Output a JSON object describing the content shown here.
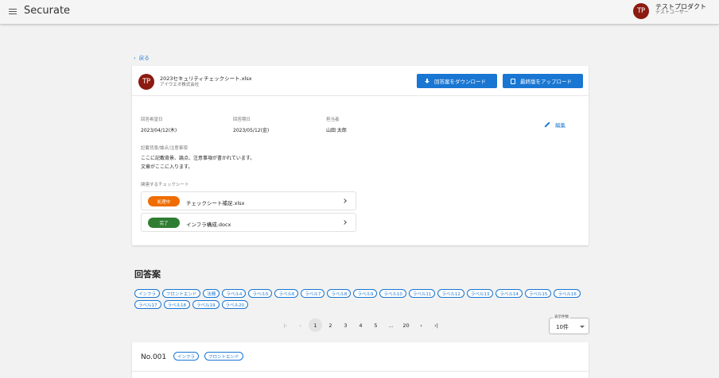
{
  "app": {
    "title": "Securate",
    "user_initials": "TP",
    "user_name": "テストプロダクト",
    "user_role": "テストユーザー"
  },
  "nav": {
    "back_label": "戻る"
  },
  "sheet": {
    "avatar_initials": "TP",
    "file_name": "2023セキュリティチェックシート.xlsx",
    "company": "アイウエオ株式会社",
    "download_button": "回答案をダウンロード",
    "upload_button": "最終版をアップロード",
    "desired_date_label": "回答希望日",
    "desired_date": "2023/04/12(木)",
    "due_date_label": "回答期日",
    "due_date": "2023/05/12(金)",
    "assignee_label": "担当者",
    "assignee": "山田 太郎",
    "edit_label": "編集",
    "notes_label": "記載背景/論点/注意事項",
    "notes_line1": "ここに記載背景、論点、注意事項が書かれています。",
    "notes_line2": "文章がここに入ります。",
    "related_label": "関連するチェックシート",
    "related": [
      {
        "status": "処理中",
        "status_color": "#ef6c00",
        "name": "チェックシート補足.xlsx"
      },
      {
        "status": "完了",
        "status_color": "#2e7d32",
        "name": "インフラ構成.docx"
      }
    ]
  },
  "answers": {
    "title": "回答案",
    "tags": [
      "インフラ",
      "フロントエンド",
      "法務",
      "ラベル4",
      "ラベル5",
      "ラベル6",
      "ラベル7",
      "ラベル8",
      "ラベル9",
      "ラベル10",
      "ラベル11",
      "ラベル12",
      "ラベル13",
      "ラベル14",
      "ラベル15",
      "ラベル16",
      "ラベル17",
      "ラベル18",
      "ラベル19",
      "ラベル20"
    ],
    "pagination": {
      "pages": [
        "1",
        "2",
        "3",
        "4",
        "5",
        "…",
        "20"
      ],
      "current": "1"
    },
    "per_page_label": "表示件数",
    "per_page_value": "10件",
    "first_item": {
      "number": "No.001",
      "tags": [
        "インフラ",
        "フロントエンド"
      ]
    }
  },
  "colors": {
    "primary": "#1976d2",
    "avatar": "#8b1a10",
    "processing": "#ef6c00",
    "done": "#2e7d32"
  }
}
